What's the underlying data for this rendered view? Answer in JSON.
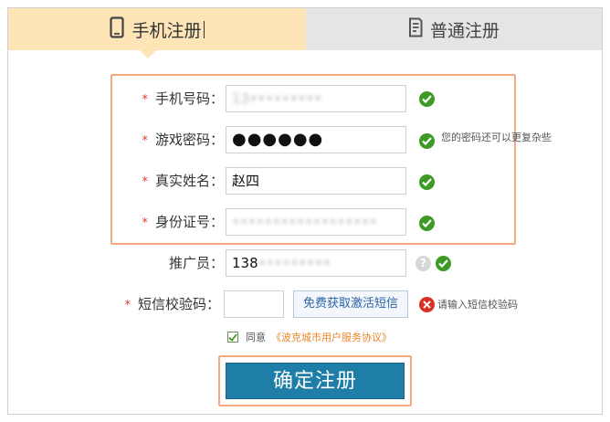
{
  "tabs": {
    "mobile_label": "手机注册",
    "normal_label": "普通注册"
  },
  "form": {
    "phone": {
      "label": "手机号码：",
      "value": "13•••••••••"
    },
    "password": {
      "label": "游戏密码：",
      "value": "●●●●●●",
      "hint": "您的密码还可以更复杂些"
    },
    "realname": {
      "label": "真实姓名：",
      "value": "赵四"
    },
    "idcard": {
      "label": "身份证号：",
      "value": "••••••••••••••••••"
    },
    "promoter": {
      "label": "推广员：",
      "value_prefix": "138",
      "value_rest": "•••••••••",
      "help": "?"
    },
    "sms": {
      "label": "短信校验码：",
      "button": "免费获取激活短信",
      "error": "请输入短信校验码"
    },
    "required_mark": "*"
  },
  "agreement": {
    "text": "同意",
    "link": "《波克城市用户服务协议》"
  },
  "submit": {
    "label": "确定注册"
  },
  "colors": {
    "tab_active_bg": "#fde5b7",
    "tab_inactive_bg": "#e5e5e5",
    "highlight_border": "#f5a97f",
    "ok_green": "#3d9b25",
    "error_red": "#d93025",
    "submit_bg": "#1f7ea8",
    "link_orange": "#e9862b"
  },
  "icons": {
    "mobile_tab": "phone-icon",
    "normal_tab": "document-icon",
    "ok": "check-circle-icon",
    "help": "question-circle-icon",
    "error": "x-circle-icon",
    "checkbox": "checkmark-icon"
  }
}
